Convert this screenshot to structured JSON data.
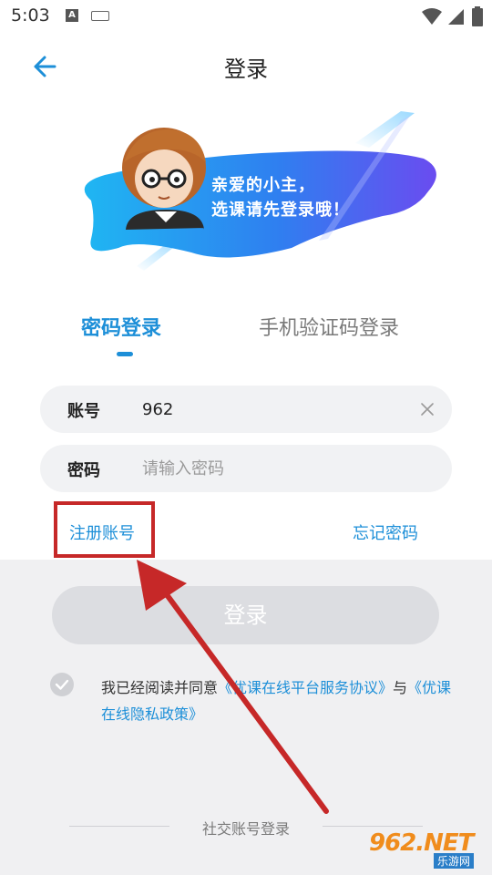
{
  "status_bar": {
    "time": "5:03",
    "notif_icon_letter": "A",
    "icons": [
      "a-notification-icon",
      "keyboard-icon",
      "wifi-icon",
      "signal-icon",
      "battery-icon"
    ]
  },
  "header": {
    "title": "登录",
    "back_icon": "arrow-left-icon"
  },
  "banner": {
    "line1": "亲爱的小主，",
    "line2": "选课请先登录哦！"
  },
  "tabs": [
    {
      "label": "密码登录",
      "active": true
    },
    {
      "label": "手机验证码登录",
      "active": false
    }
  ],
  "form": {
    "account_label": "账号",
    "account_value": "962",
    "password_label": "密码",
    "password_placeholder": "请输入密码"
  },
  "links": {
    "register": "注册账号",
    "forgot": "忘记密码"
  },
  "login_button": "登录",
  "agreement": {
    "prefix": "我已经阅读并同意",
    "service_link": "《优课在线平台服务协议》",
    "conjunction": "与",
    "privacy_link": "《优课在线隐私政策》"
  },
  "social_login_label": "社交账号登录",
  "watermark": {
    "main": "962.NET",
    "sub": "乐游网"
  },
  "colors": {
    "accent": "#1d8fd8",
    "annotation": "#c62828",
    "button_disabled": "#dcdde1"
  }
}
